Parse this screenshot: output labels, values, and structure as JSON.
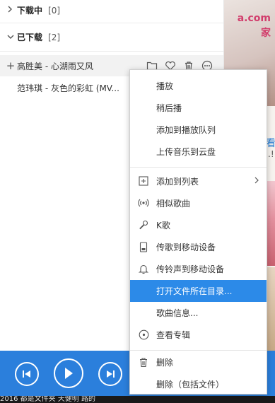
{
  "downloads": {
    "downloading": {
      "label": "下载中",
      "count": "[0]"
    },
    "downloaded": {
      "label": "已下载",
      "count": "[2]"
    },
    "items": [
      {
        "title": "高胜美 - 心湖雨又风"
      },
      {
        "title": "范玮琪 - 灰色的彩虹 (MV..."
      }
    ]
  },
  "context_menu": {
    "items": [
      {
        "label": "播放",
        "icon": ""
      },
      {
        "label": "稍后播",
        "icon": ""
      },
      {
        "label": "添加到播放队列",
        "icon": ""
      },
      {
        "label": "上传音乐到云盘",
        "icon": ""
      },
      {
        "label": "添加到列表",
        "icon": "plus-square-icon"
      },
      {
        "label": "相似歌曲",
        "icon": "radio-waves-icon"
      },
      {
        "label": "K歌",
        "icon": "microphone-icon"
      },
      {
        "label": "传歌到移动设备",
        "icon": "device-icon"
      },
      {
        "label": "传铃声到移动设备",
        "icon": "bell-icon"
      },
      {
        "label": "打开文件所在目录...",
        "icon": "",
        "highlighted": true
      },
      {
        "label": "歌曲信息...",
        "icon": ""
      },
      {
        "label": "查看专辑",
        "icon": "album-disc-icon"
      },
      {
        "label": "删除",
        "icon": "trash-icon"
      },
      {
        "label": "删除（包括文件）",
        "icon": ""
      }
    ]
  },
  "side_panel": {
    "watermark_1": "a.com",
    "watermark_2": "家",
    "link_text": "看",
    "dots": ".!"
  },
  "status_strip": {
    "text": "2016 都是文件夹 天健明 路的"
  },
  "colors": {
    "accent": "#2c8ae8",
    "player_bar": "#2b7fdc",
    "menu_border": "#cfcfcf"
  }
}
